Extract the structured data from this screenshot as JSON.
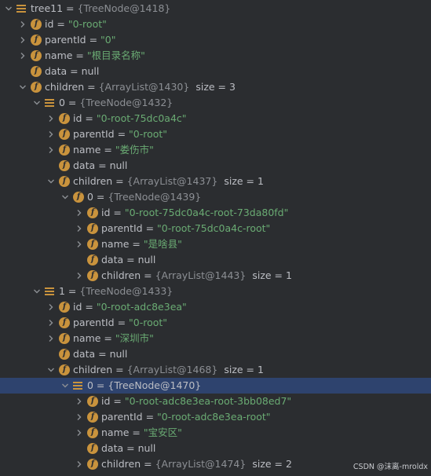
{
  "watermark": "CSDN @沫离-mroldx",
  "rows": [
    {
      "kind": "obj",
      "name": "tree11",
      "value": "{TreeNode@1418}",
      "expanded": true,
      "depth": 0
    },
    {
      "kind": "field",
      "name": "id",
      "value": "\"0-root\"",
      "vtype": "str",
      "expandable": true,
      "depth": 1
    },
    {
      "kind": "field",
      "name": "parentId",
      "value": "\"0\"",
      "vtype": "str",
      "expandable": true,
      "depth": 1
    },
    {
      "kind": "field",
      "name": "name",
      "value": "\"根目录名称\"",
      "vtype": "str",
      "expandable": true,
      "depth": 1
    },
    {
      "kind": "field",
      "name": "data",
      "value": "null",
      "vtype": "kw",
      "expandable": false,
      "depth": 1
    },
    {
      "kind": "field",
      "name": "children",
      "value": "{ArrayList@1430}",
      "vtype": "cls",
      "size": "size = 3",
      "expandable": true,
      "expanded": true,
      "depth": 1
    },
    {
      "kind": "obj",
      "name": "0",
      "value": "{TreeNode@1432}",
      "expanded": true,
      "depth": 2
    },
    {
      "kind": "field",
      "name": "id",
      "value": "\"0-root-75dc0a4c\"",
      "vtype": "str",
      "expandable": true,
      "depth": 3
    },
    {
      "kind": "field",
      "name": "parentId",
      "value": "\"0-root\"",
      "vtype": "str",
      "expandable": true,
      "depth": 3
    },
    {
      "kind": "field",
      "name": "name",
      "value": "\"娄伤市\"",
      "vtype": "str",
      "expandable": true,
      "depth": 3
    },
    {
      "kind": "field",
      "name": "data",
      "value": "null",
      "vtype": "kw",
      "expandable": false,
      "depth": 3
    },
    {
      "kind": "field",
      "name": "children",
      "value": "{ArrayList@1437}",
      "vtype": "cls",
      "size": "size = 1",
      "expandable": true,
      "expanded": true,
      "depth": 3
    },
    {
      "kind": "field",
      "name": "0",
      "value": "{TreeNode@1439}",
      "vtype": "cls",
      "expandable": true,
      "expanded": true,
      "depth": 4
    },
    {
      "kind": "field",
      "name": "id",
      "value": "\"0-root-75dc0a4c-root-73da80fd\"",
      "vtype": "str",
      "expandable": true,
      "depth": 5
    },
    {
      "kind": "field",
      "name": "parentId",
      "value": "\"0-root-75dc0a4c-root\"",
      "vtype": "str",
      "expandable": true,
      "depth": 5
    },
    {
      "kind": "field",
      "name": "name",
      "value": "\"是啥县\"",
      "vtype": "str",
      "expandable": true,
      "depth": 5
    },
    {
      "kind": "field",
      "name": "data",
      "value": "null",
      "vtype": "kw",
      "expandable": false,
      "depth": 5
    },
    {
      "kind": "field",
      "name": "children",
      "value": "{ArrayList@1443}",
      "vtype": "cls",
      "size": "size = 1",
      "expandable": true,
      "expanded": false,
      "depth": 5
    },
    {
      "kind": "obj",
      "name": "1",
      "value": "{TreeNode@1433}",
      "expanded": true,
      "depth": 2
    },
    {
      "kind": "field",
      "name": "id",
      "value": "\"0-root-adc8e3ea\"",
      "vtype": "str",
      "expandable": true,
      "depth": 3
    },
    {
      "kind": "field",
      "name": "parentId",
      "value": "\"0-root\"",
      "vtype": "str",
      "expandable": true,
      "depth": 3
    },
    {
      "kind": "field",
      "name": "name",
      "value": "\"深圳市\"",
      "vtype": "str",
      "expandable": true,
      "depth": 3
    },
    {
      "kind": "field",
      "name": "data",
      "value": "null",
      "vtype": "kw",
      "expandable": false,
      "depth": 3
    },
    {
      "kind": "field",
      "name": "children",
      "value": "{ArrayList@1468}",
      "vtype": "cls",
      "size": "size = 1",
      "expandable": true,
      "expanded": true,
      "depth": 3
    },
    {
      "kind": "obj",
      "name": "0",
      "value": "{TreeNode@1470}",
      "expanded": true,
      "selected": true,
      "depth": 4
    },
    {
      "kind": "field",
      "name": "id",
      "value": "\"0-root-adc8e3ea-root-3bb08ed7\"",
      "vtype": "str",
      "expandable": true,
      "depth": 5
    },
    {
      "kind": "field",
      "name": "parentId",
      "value": "\"0-root-adc8e3ea-root\"",
      "vtype": "str",
      "expandable": true,
      "depth": 5
    },
    {
      "kind": "field",
      "name": "name",
      "value": "\"宝安区\"",
      "vtype": "str",
      "expandable": true,
      "depth": 5
    },
    {
      "kind": "field",
      "name": "data",
      "value": "null",
      "vtype": "kw",
      "expandable": false,
      "depth": 5
    },
    {
      "kind": "field",
      "name": "children",
      "value": "{ArrayList@1474}",
      "vtype": "cls",
      "size": "size = 2",
      "expandable": true,
      "expanded": false,
      "depth": 5
    }
  ]
}
